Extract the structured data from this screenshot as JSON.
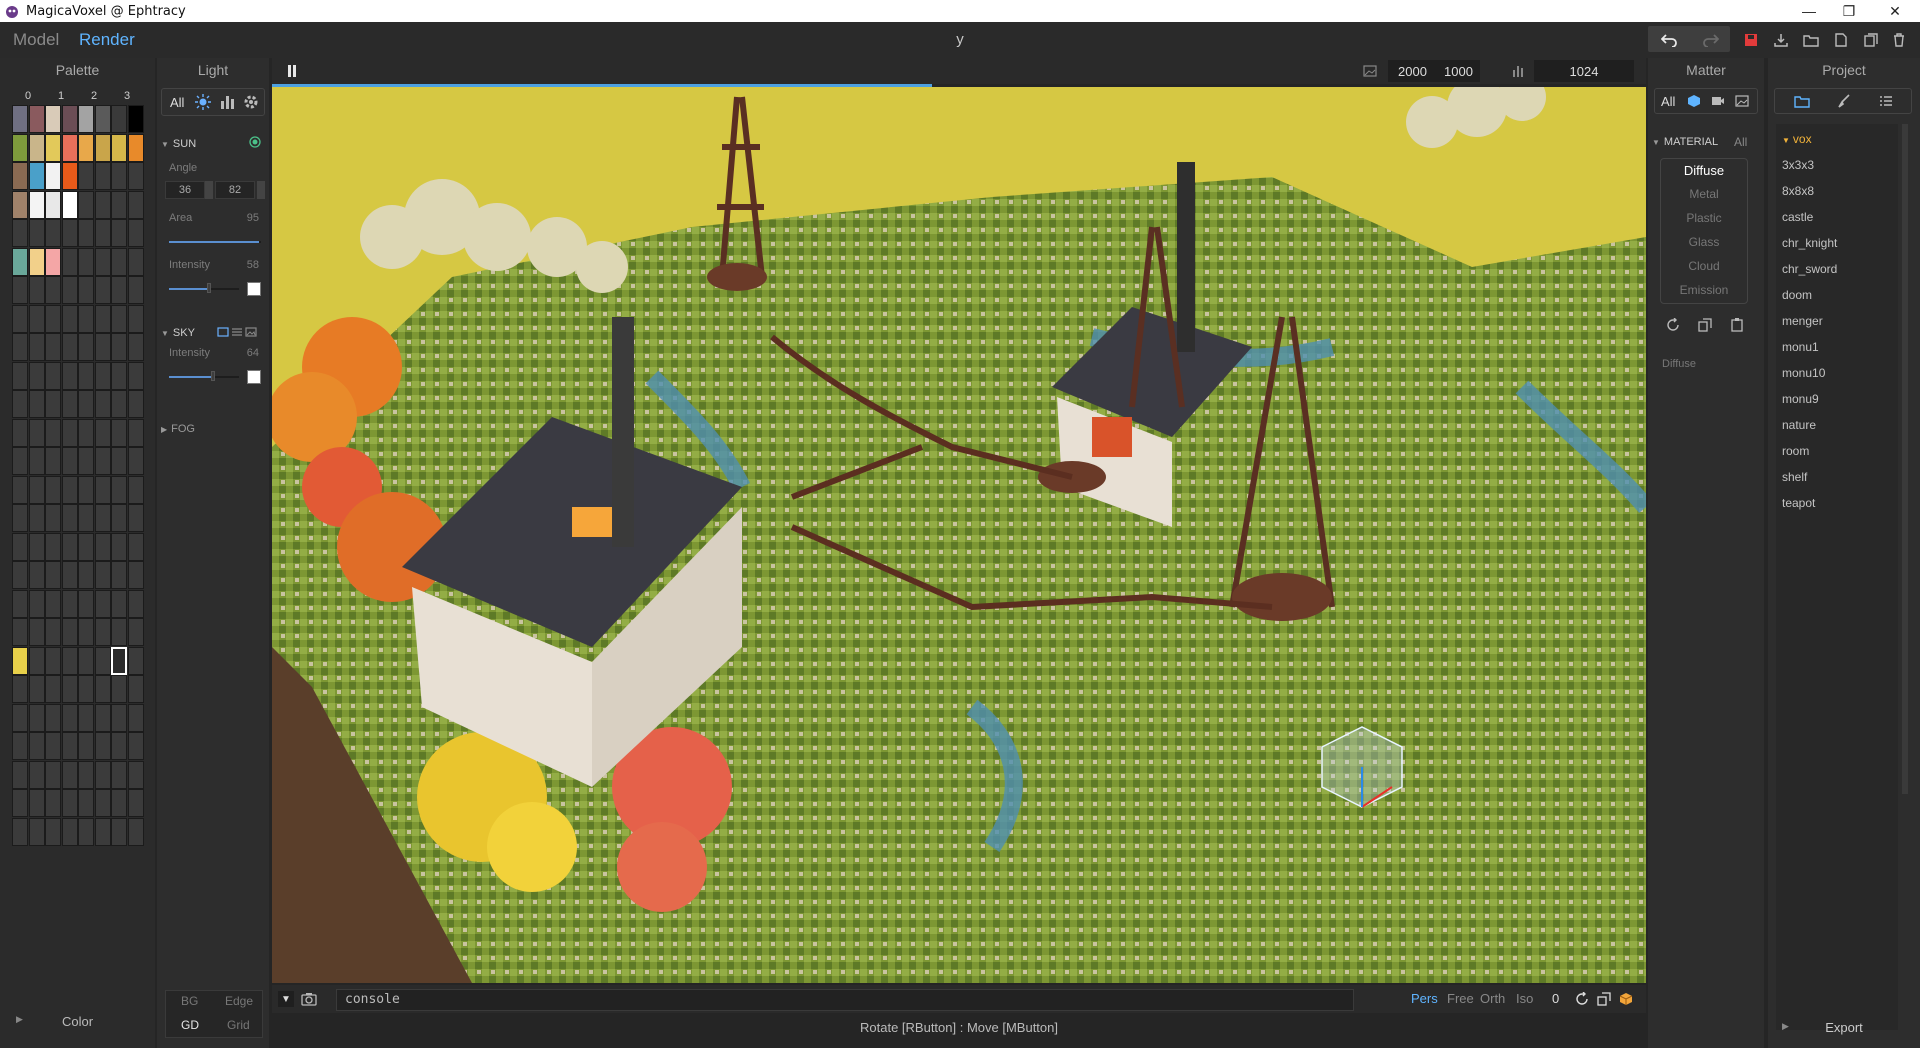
{
  "window": {
    "title": "MagicaVoxel @ Ephtracy",
    "controls": [
      "minimize",
      "restore",
      "close"
    ]
  },
  "header": {
    "tabs": [
      {
        "label": "Model",
        "active": false
      },
      {
        "label": "Render",
        "active": true
      }
    ],
    "center_title": "y",
    "tools": [
      "undo-icon",
      "redo-icon",
      "save-icon",
      "export-icon",
      "open-folder-icon",
      "new-file-icon",
      "copy-file-icon",
      "delete-icon"
    ]
  },
  "palette": {
    "title": "Palette",
    "columns": [
      "0",
      "1",
      "2",
      "3"
    ],
    "footer": "Color",
    "colors": {
      "r0": [
        "#6f6f82",
        "#8a5a5e",
        "#d9cbb8",
        "#6b4d55",
        "#a3a3a3",
        "#5a5a5a",
        "#3a3a3a",
        "#000000"
      ],
      "r1": [
        "#7e9b3c",
        "#c9b58a",
        "#e2c95a",
        "#e86f5a",
        "#e8a84a",
        "#c9a54a",
        "#d6b84a",
        "#e88a2a"
      ],
      "r2": [
        "#8a6a52",
        "#4aa0c9",
        "#f2f2f2",
        "#e85a1a",
        "#3b3b3b",
        "#3b3b3b",
        "#3b3b3b",
        "#3b3b3b"
      ],
      "r3": [
        "#a0826a",
        "#f4f4f4",
        "#e8e8e8",
        "#ffffff",
        "#3b3b3b",
        "#3b3b3b",
        "#3b3b3b",
        "#3b3b3b"
      ],
      "r5": [
        "#6aa89a",
        "#f2d08a",
        "#f4a6a6",
        "#3b3b3b",
        "#3b3b3b",
        "#3b3b3b",
        "#3b3b3b",
        "#3b3b3b"
      ],
      "r19": [
        "#e8d04a",
        "#3b3b3b",
        "#3b3b3b",
        "#3b3b3b",
        "#3b3b3b",
        "#3b3b3b",
        "#3b3b3b",
        "#3b3b3b"
      ]
    },
    "selected_index": "r19c6"
  },
  "light": {
    "title": "Light",
    "tabs": [
      "All",
      "sun-icon",
      "chart-icon",
      "gear-icon"
    ],
    "sun": {
      "label": "SUN",
      "angle_label": "Angle",
      "angle_a": "36",
      "angle_b": "82",
      "area_label": "Area",
      "area_value": "95",
      "intensity_label": "Intensity",
      "intensity_value": "58"
    },
    "sky": {
      "label": "SKY",
      "intensity_label": "Intensity",
      "intensity_value": "64"
    },
    "fog": {
      "label": "FOG"
    },
    "bottom": {
      "bg": "BG",
      "edge": "Edge",
      "gd": "GD",
      "grid": "Grid"
    }
  },
  "viewport": {
    "width": "2000",
    "height": "1000",
    "samples": "1024",
    "render_progress": 0.48,
    "sky_color": "#d6c843",
    "console_placeholder": "console",
    "camera_modes": [
      {
        "label": "Pers",
        "active": true
      },
      {
        "label": "Free",
        "active": false
      },
      {
        "label": "Orth",
        "active": false
      },
      {
        "label": "Iso",
        "active": false
      }
    ],
    "camera_count": "0",
    "status": "Rotate [RButton] : Move [MButton]"
  },
  "matter": {
    "title": "Matter",
    "tabs": [
      "All",
      "cube-icon",
      "camera-icon",
      "image-icon"
    ],
    "material_label": "MATERIAL",
    "material_filter": "All",
    "materials": [
      "Diffuse",
      "Metal",
      "Plastic",
      "Glass",
      "Cloud",
      "Emission"
    ],
    "active_material": "Diffuse",
    "current_label": "Diffuse"
  },
  "project": {
    "title": "Project",
    "folder": "vox",
    "files": [
      "3x3x3",
      "8x8x8",
      "castle",
      "chr_knight",
      "chr_sword",
      "doom",
      "menger",
      "monu1",
      "monu10",
      "monu9",
      "nature",
      "room",
      "shelf",
      "teapot"
    ],
    "footer": "Export"
  }
}
